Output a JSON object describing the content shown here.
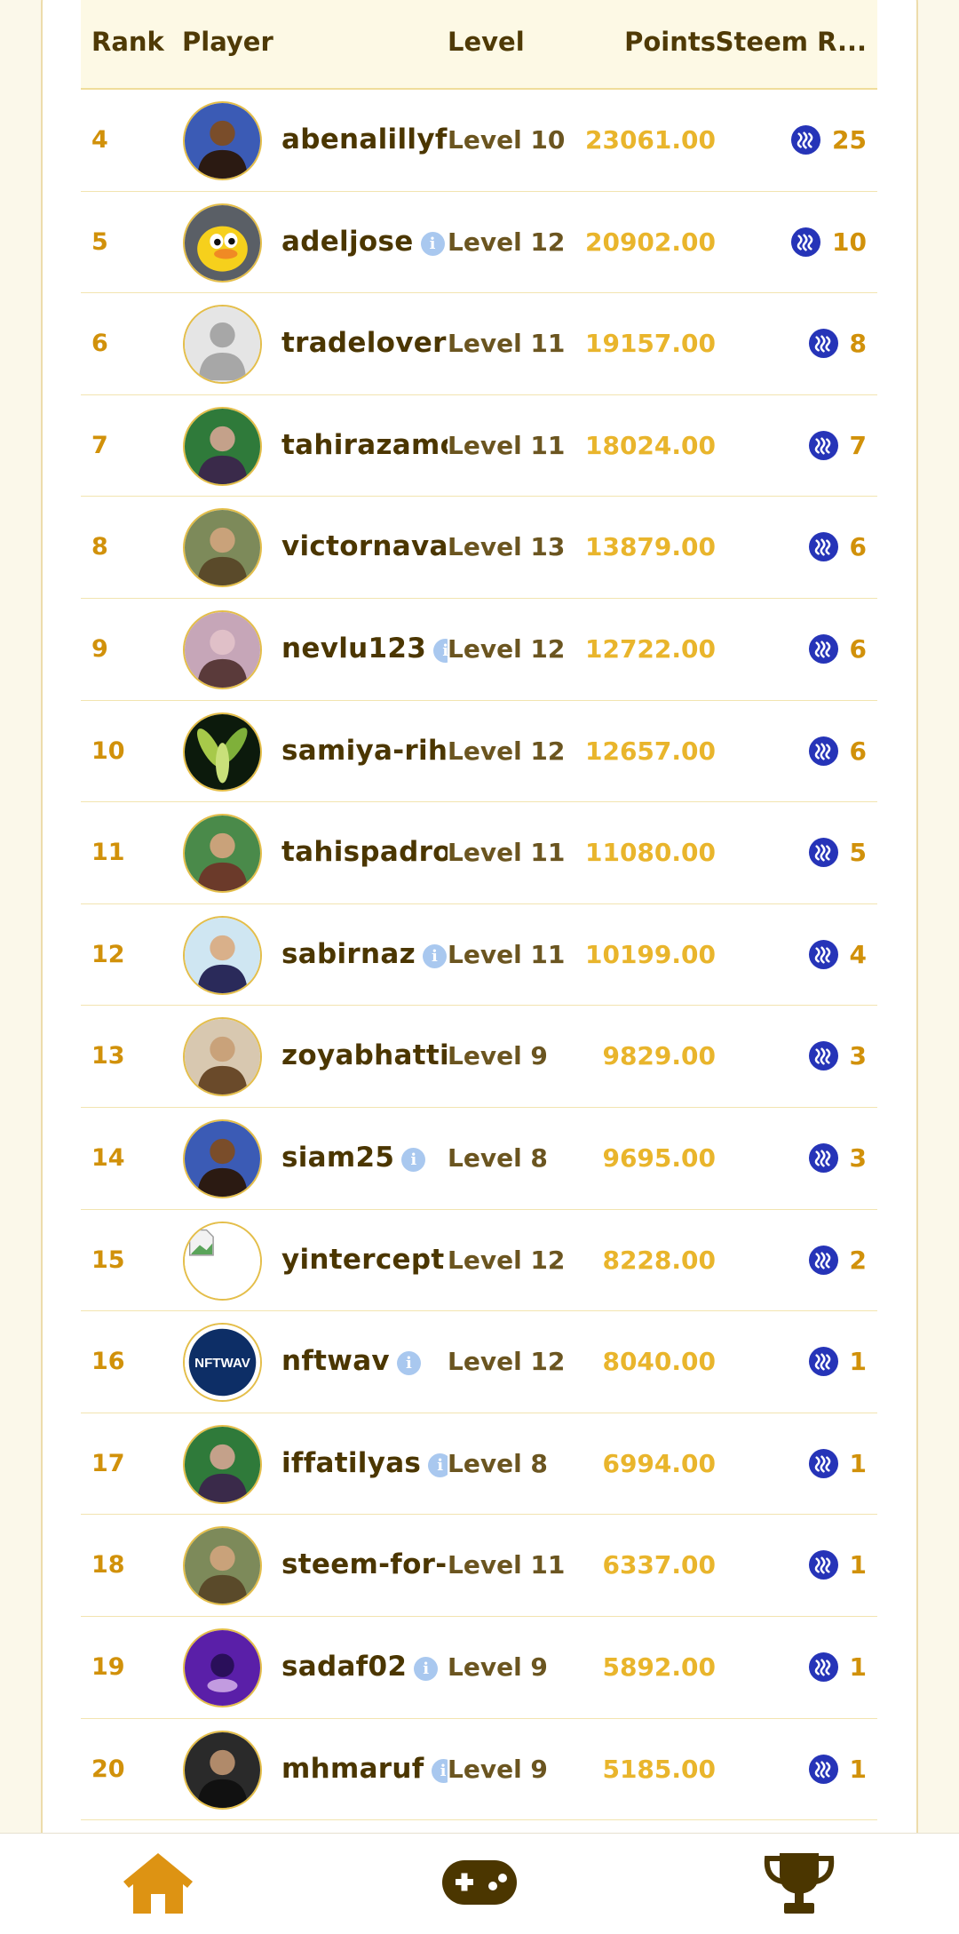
{
  "headers": {
    "rank": "Rank",
    "player": "Player",
    "level": "Level",
    "points": "Points",
    "reward": "Steem R..."
  },
  "rows": [
    {
      "rank": "4",
      "name": "abenalillyf",
      "info": false,
      "level": "Level 10",
      "points": "23061.00",
      "reward": "25",
      "avatar": "photo"
    },
    {
      "rank": "5",
      "name": "adeljose",
      "info": true,
      "level": "Level 12",
      "points": "20902.00",
      "reward": "10",
      "avatar": "duck"
    },
    {
      "rank": "6",
      "name": "tradelover",
      "info": false,
      "level": "Level 11",
      "points": "19157.00",
      "reward": "8",
      "avatar": "default"
    },
    {
      "rank": "7",
      "name": "tahirazamc",
      "info": false,
      "level": "Level 11",
      "points": "18024.00",
      "reward": "7",
      "avatar": "photo"
    },
    {
      "rank": "8",
      "name": "victornava",
      "info": false,
      "level": "Level 13",
      "points": "13879.00",
      "reward": "6",
      "avatar": "photo"
    },
    {
      "rank": "9",
      "name": "nevlu123",
      "info": true,
      "level": "Level 12",
      "points": "12722.00",
      "reward": "6",
      "avatar": "photo"
    },
    {
      "rank": "10",
      "name": "samiya-rih",
      "info": false,
      "level": "Level 12",
      "points": "12657.00",
      "reward": "6",
      "avatar": "leaves"
    },
    {
      "rank": "11",
      "name": "tahispadro",
      "info": false,
      "level": "Level 11",
      "points": "11080.00",
      "reward": "5",
      "avatar": "photo"
    },
    {
      "rank": "12",
      "name": "sabirnaz",
      "info": true,
      "level": "Level 11",
      "points": "10199.00",
      "reward": "4",
      "avatar": "photo"
    },
    {
      "rank": "13",
      "name": "zoyabhatti",
      "info": false,
      "level": "Level 9",
      "points": "9829.00",
      "reward": "3",
      "avatar": "photo"
    },
    {
      "rank": "14",
      "name": "siam25",
      "info": true,
      "level": "Level 8",
      "points": "9695.00",
      "reward": "3",
      "avatar": "photo"
    },
    {
      "rank": "15",
      "name": "yintercept",
      "info": false,
      "level": "Level 12",
      "points": "8228.00",
      "reward": "2",
      "avatar": "broken"
    },
    {
      "rank": "16",
      "name": "nftwav",
      "info": true,
      "level": "Level 12",
      "points": "8040.00",
      "reward": "1",
      "avatar": "nftwav"
    },
    {
      "rank": "17",
      "name": "iffatilyas",
      "info": true,
      "level": "Level 8",
      "points": "6994.00",
      "reward": "1",
      "avatar": "photo"
    },
    {
      "rank": "18",
      "name": "steem-for-",
      "info": false,
      "level": "Level 11",
      "points": "6337.00",
      "reward": "1",
      "avatar": "photo"
    },
    {
      "rank": "19",
      "name": "sadaf02",
      "info": true,
      "level": "Level 9",
      "points": "5892.00",
      "reward": "1",
      "avatar": "purple"
    },
    {
      "rank": "20",
      "name": "mhmaruf",
      "info": true,
      "level": "Level 9",
      "points": "5185.00",
      "reward": "1",
      "avatar": "photo"
    }
  ],
  "nftwav_logo_text": "NFTWAV",
  "info_glyph": "i",
  "nav": [
    {
      "name": "home",
      "icon": "home-icon"
    },
    {
      "name": "games",
      "icon": "gamepad-icon"
    },
    {
      "name": "leaderboard",
      "icon": "trophy-icon"
    }
  ],
  "colors": {
    "rank": "#d1910a",
    "points": "#e9b52c",
    "steem": "#2634b8",
    "nav": "#dd9313",
    "nav_dark": "#4b3600"
  }
}
